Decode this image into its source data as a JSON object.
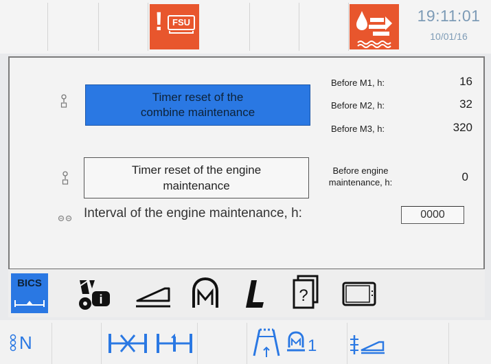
{
  "header": {
    "warning_label": "FSU",
    "time": "19:11:01",
    "date": "10/01/16"
  },
  "panel": {
    "combine_button": "Timer reset of the combine maintenance",
    "combine_button_lines": [
      "Timer reset of the",
      "combine maintenance"
    ],
    "engine_button_lines": [
      "Timer reset of the engine",
      "maintenance"
    ],
    "counters": [
      {
        "label": "Before M1, h:",
        "value": "16"
      },
      {
        "label": "Before M2, h:",
        "value": "32"
      },
      {
        "label": "Before M3, h:",
        "value": "320"
      }
    ],
    "engine_counter": {
      "label_lines": [
        "Before engine",
        "maintenance, h:"
      ],
      "value": "0"
    },
    "interval": {
      "label": "Interval of the engine maintenance, h:",
      "value": "0000"
    }
  },
  "tabs": [
    {
      "label": "BICS",
      "icon": "bics-icon",
      "active": true
    },
    {
      "icon": "tractor-info-icon"
    },
    {
      "icon": "header-platform-icon"
    },
    {
      "icon": "engine-m-icon"
    },
    {
      "icon": "italic-l-icon"
    },
    {
      "icon": "manual-help-icon"
    },
    {
      "icon": "display-screen-icon"
    }
  ],
  "bottom_bar": {
    "gear": "N",
    "icons": [
      "gear-neutral-icon",
      "axle-lock-icon",
      "axle-diff-icon",
      "reel-lift-icon",
      "engine-mode-icon",
      "header-height-icon"
    ],
    "engine_mode_value": "1"
  },
  "colors": {
    "accent_blue": "#2a78e3",
    "warning_orange": "#e8562d",
    "time_color": "#7d9bb6"
  }
}
